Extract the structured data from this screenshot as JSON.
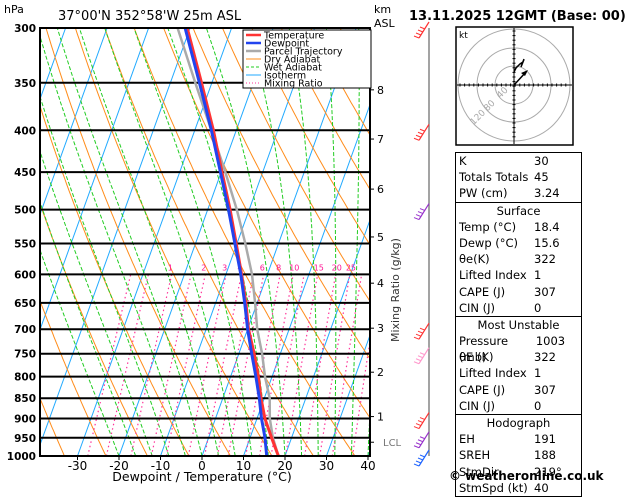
{
  "header": {
    "location": "37°00'N  352°58'W  25m  ASL",
    "datetime": "13.11.2025 12GMT (Base: 00)",
    "left_unit": "hPa",
    "right_unit_1": "km",
    "right_unit_2": "ASL"
  },
  "chart_data": {
    "type": "line",
    "subtype": "skew-T log-P",
    "xlabel": "Dewpoint / Temperature (°C)",
    "ylabel_right": "Mixing Ratio (g/kg)",
    "xlim": [
      -40,
      40
    ],
    "ylim_hpa": [
      1000,
      300
    ],
    "x_ticks": [
      -30,
      -20,
      -10,
      0,
      10,
      20,
      30,
      40
    ],
    "pressure_ticks": [
      300,
      350,
      400,
      450,
      500,
      550,
      600,
      650,
      700,
      750,
      800,
      850,
      900,
      950,
      1000
    ],
    "km_ticks": [
      {
        "label": "8",
        "p": 357
      },
      {
        "label": "7",
        "p": 410
      },
      {
        "label": "6",
        "p": 472
      },
      {
        "label": "5",
        "p": 540
      },
      {
        "label": "4",
        "p": 615
      },
      {
        "label": "3",
        "p": 698
      },
      {
        "label": "2",
        "p": 790
      },
      {
        "label": "1",
        "p": 895
      },
      {
        "label": "LCL",
        "p": 962
      }
    ],
    "mixing_ratio_labels": [
      1,
      2,
      3,
      4,
      6,
      8,
      10,
      15,
      20,
      25
    ],
    "legend": {
      "placement": "top-right",
      "entries": [
        {
          "name": "Temperature",
          "color": "#ff3333",
          "style": "solid-thick"
        },
        {
          "name": "Dewpoint",
          "color": "#2244ee",
          "style": "solid-thick"
        },
        {
          "name": "Parcel Trajectory",
          "color": "#aaaaaa",
          "style": "solid-thick"
        },
        {
          "name": "Dry Adiabat",
          "color": "#ff8c1a",
          "style": "solid"
        },
        {
          "name": "Wet Adiabat",
          "color": "#22cc22",
          "style": "dashed"
        },
        {
          "name": "Isotherm",
          "color": "#22aaff",
          "style": "solid"
        },
        {
          "name": "Mixing Ratio",
          "color": "#ff3399",
          "style": "dotted"
        }
      ]
    },
    "series": [
      {
        "name": "Temperature",
        "p": [
          1000,
          950,
          900,
          850,
          800,
          750,
          700,
          650,
          600,
          550,
          500,
          450,
          400,
          350,
          300
        ],
        "t": [
          18.4,
          15.2,
          11.9,
          9.2,
          6.7,
          3.7,
          0.2,
          -2.7,
          -6.2,
          -10.2,
          -14.6,
          -19.8,
          -25.5,
          -32.5,
          -40.7
        ]
      },
      {
        "name": "Dewpoint",
        "p": [
          1000,
          950,
          900,
          850,
          800,
          750,
          700,
          650,
          600,
          550,
          500,
          450,
          400,
          350,
          300
        ],
        "t": [
          15.6,
          13.6,
          11.1,
          8.8,
          6.1,
          3.1,
          0.0,
          -3.0,
          -6.4,
          -10.5,
          -15.0,
          -20.2,
          -26.0,
          -33.0,
          -41.2
        ]
      },
      {
        "name": "Parcel Trajectory",
        "p": [
          1000,
          950,
          900,
          850,
          800,
          750,
          700,
          650,
          600,
          550,
          500,
          450,
          400,
          350,
          300
        ],
        "t": [
          18.4,
          15.5,
          13.1,
          11.3,
          8.3,
          5.6,
          2.3,
          -0.5,
          -3.7,
          -8.0,
          -13.0,
          -19.0,
          -26.0,
          -34.0,
          -43.0
        ]
      }
    ],
    "wind_barbs": [
      {
        "p": 300,
        "color": "#ff3333"
      },
      {
        "p": 400,
        "color": "#ff3333"
      },
      {
        "p": 500,
        "color": "#9933cc"
      },
      {
        "p": 700,
        "color": "#ff3333"
      },
      {
        "p": 750,
        "color": "#ff99cc"
      },
      {
        "p": 900,
        "color": "#ff3333"
      },
      {
        "p": 950,
        "color": "#9933cc"
      },
      {
        "p": 1000,
        "color": "#2266ff"
      }
    ],
    "hodograph": {
      "unit_label": "kt",
      "rings": [
        40,
        80,
        120
      ]
    }
  },
  "table": {
    "top": [
      {
        "k": "K",
        "v": "30"
      },
      {
        "k": "Totals Totals",
        "v": "45"
      },
      {
        "k": "PW (cm)",
        "v": "3.24"
      }
    ],
    "surface": {
      "title": "Surface",
      "rows": [
        {
          "k": "Temp (°C)",
          "v": "18.4"
        },
        {
          "k": "Dewp (°C)",
          "v": "15.6"
        },
        {
          "k": "θe(K)",
          "v": "322"
        },
        {
          "k": "Lifted Index",
          "v": "1"
        },
        {
          "k": "CAPE (J)",
          "v": "307"
        },
        {
          "k": "CIN (J)",
          "v": "0"
        }
      ]
    },
    "most_unstable": {
      "title": "Most Unstable",
      "rows": [
        {
          "k": "Pressure (mb)",
          "v": "1003"
        },
        {
          "k": "θE (K)",
          "v": "322"
        },
        {
          "k": "Lifted Index",
          "v": "1"
        },
        {
          "k": "CAPE (J)",
          "v": "307"
        },
        {
          "k": "CIN (J)",
          "v": "0"
        }
      ]
    },
    "hodograph": {
      "title": "Hodograph",
      "rows": [
        {
          "k": "EH",
          "v": "191"
        },
        {
          "k": "SREH",
          "v": "188"
        },
        {
          "k": "StmDir",
          "v": "219°"
        },
        {
          "k": "StmSpd (kt)",
          "v": "40"
        }
      ]
    }
  },
  "footer": "© weatheronline.co.uk"
}
